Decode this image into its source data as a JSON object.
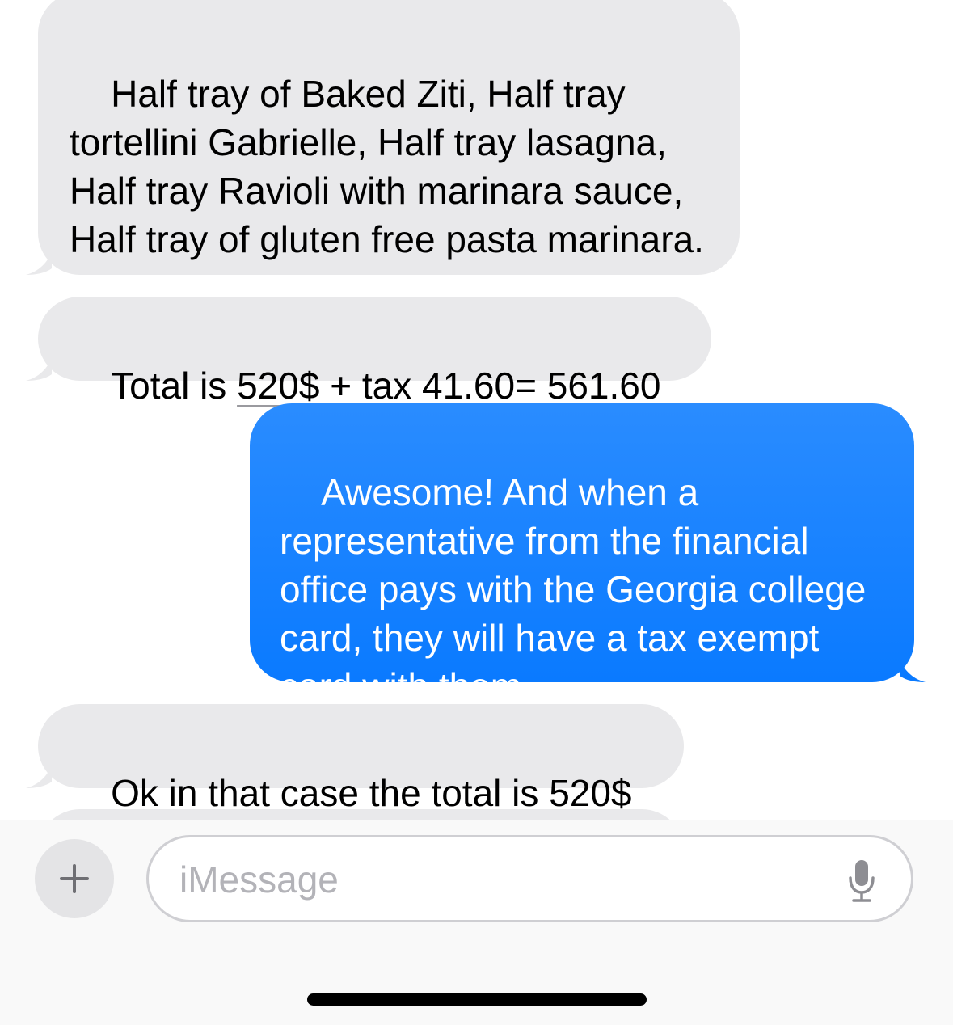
{
  "messages": [
    {
      "direction": "incoming",
      "text": "Half tray of Baked Ziti, Half tray tortellini Gabrielle, Half tray lasagna, Half tray Ravioli with marinara sauce, Half tray of gluten free pasta marinara."
    },
    {
      "direction": "incoming",
      "text_before": "Total is ",
      "link": "520$",
      "text_after": " + tax 41.60= 561.60"
    },
    {
      "direction": "outgoing",
      "text": "Awesome! And when a representative from the financial office pays with the Georgia college card, they will have a tax exempt card with them"
    },
    {
      "direction": "incoming",
      "text_before": "Ok in that case the total is ",
      "link": "520$"
    }
  ],
  "composer": {
    "placeholder": "iMessage",
    "add_icon": "plus-icon",
    "mic_icon": "microphone-icon"
  },
  "colors": {
    "incoming_bubble": "#e9e9eb",
    "outgoing_bubble": "#0a7aff",
    "placeholder": "#b3b3b8"
  }
}
